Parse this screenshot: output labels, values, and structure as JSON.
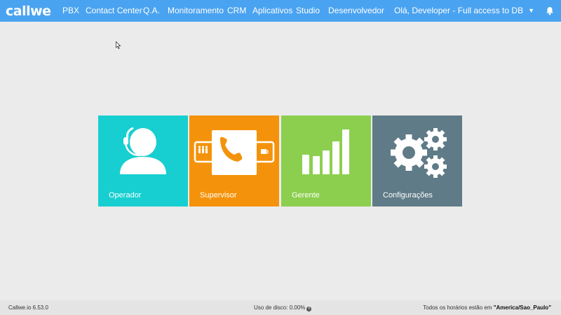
{
  "header": {
    "logo": "callwe",
    "nav": [
      "PBX",
      "Contact Center",
      "Q.A.",
      "Monitoramento",
      "CRM",
      "Aplicativos",
      "Studio",
      "Desenvolvedor"
    ],
    "user_greeting": "Olá, Developer - Full access to DB"
  },
  "tiles": [
    {
      "label": "Operador",
      "color": "#17cfd0",
      "icon": "operator-headset-icon"
    },
    {
      "label": "Supervisor",
      "color": "#f4930b",
      "icon": "phone-supervisor-icon"
    },
    {
      "label": "Gerente",
      "color": "#8ccf4e",
      "icon": "bar-chart-icon"
    },
    {
      "label": "Configurações",
      "color": "#5f7b87",
      "icon": "gears-icon"
    }
  ],
  "footer": {
    "version": "Callwe.io 6.53.0",
    "disk": "Uso de disco: 0.00%",
    "timezone_prefix": "Todos os horários estão em ",
    "timezone": "\"America/Sao_Paulo\""
  }
}
